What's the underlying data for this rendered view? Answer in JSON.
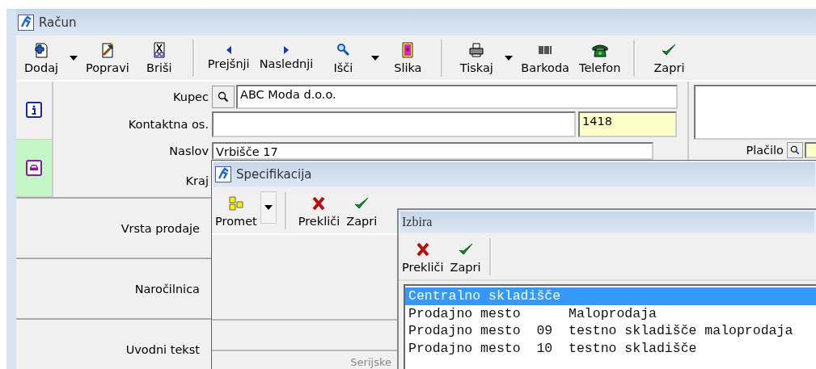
{
  "window": {
    "title": "Račun"
  },
  "toolbar": [
    [
      {
        "label": "Dodaj",
        "dropdown": true
      },
      {
        "label": "Popravi",
        "dropdown": false
      },
      {
        "label": "Briši",
        "dropdown": false
      }
    ],
    [
      {
        "label": "Prejšnji",
        "dropdown": false
      },
      {
        "label": "Naslednji",
        "dropdown": false
      },
      {
        "label": "Išči",
        "dropdown": true
      },
      {
        "label": "Slika",
        "dropdown": false
      }
    ],
    [
      {
        "label": "Tiskaj",
        "dropdown": true
      },
      {
        "label": "Barkoda",
        "dropdown": false
      },
      {
        "label": "Telefon",
        "dropdown": false
      }
    ],
    [
      {
        "label": "Zapri",
        "dropdown": false
      }
    ]
  ],
  "side_tabs": [
    {
      "selected": false
    },
    {
      "selected": true
    }
  ],
  "form": {
    "customer": {
      "label": "Kupec",
      "value": "ABC Moda d.o.o."
    },
    "contact": {
      "label": "Kontaktna os.",
      "code": "1418"
    },
    "address": {
      "label": "Naslov",
      "value": "Vrbišče 17"
    },
    "city": {
      "label": "Kraj"
    },
    "payment": {
      "label": "Plačilo"
    }
  },
  "sections": [
    {
      "label": "Vrsta prodaje"
    },
    {
      "label": "Naročilnica"
    },
    {
      "label": "Uvodni tekst"
    }
  ],
  "specification": {
    "title": "Specifikacija",
    "toolbar": [
      {
        "label": "Promet",
        "dropdown": true
      },
      {
        "label": "Prekliči",
        "dropdown": false
      },
      {
        "label": "Zapri",
        "dropdown": false
      }
    ],
    "footer_label": "Serijske"
  },
  "selection": {
    "title": "Izbira",
    "toolbar": [
      {
        "label": "Prekliči"
      },
      {
        "label": "Zapri"
      }
    ],
    "items": [
      {
        "text": "Centralno skladišče",
        "selected": true
      },
      {
        "text": "Prodajno mesto      Maloprodaja",
        "selected": false
      },
      {
        "text": "Prodajno mesto  09  testno skladišče maloprodaja",
        "selected": false
      },
      {
        "text": "Prodajno mesto  10  testno skladišče",
        "selected": false
      }
    ]
  }
}
